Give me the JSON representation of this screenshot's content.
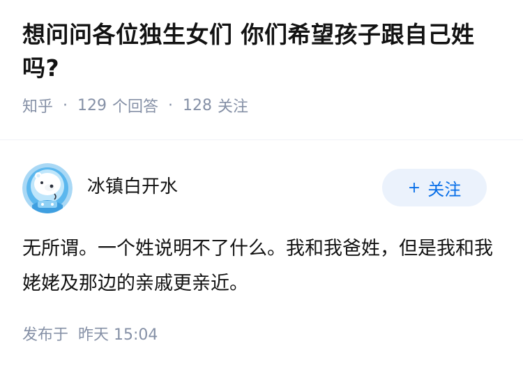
{
  "question": {
    "title": "想问问各位独生女们 你们希望孩子跟自己姓吗?",
    "source": "知乎",
    "answers_count": "129",
    "answers_label": "个回答",
    "followers_count": "128",
    "followers_label": "关注",
    "separator": "·"
  },
  "author": {
    "name": "冰镇白开水",
    "avatar_icon": "cartoon-polar-bear-astronaut-avatar",
    "follow_plus": "+",
    "follow_label": "关注"
  },
  "answer": {
    "text": "无所谓。一个姓说明不了什么。我和我爸姓，但是我和我姥姥及那边的亲戚更亲近。",
    "published_label": "发布于",
    "published_time": "昨天 15:04"
  },
  "colors": {
    "accent": "#056de8",
    "follow_bg": "#ebf2fc",
    "meta_gray": "#8590a6",
    "text": "#121212"
  }
}
